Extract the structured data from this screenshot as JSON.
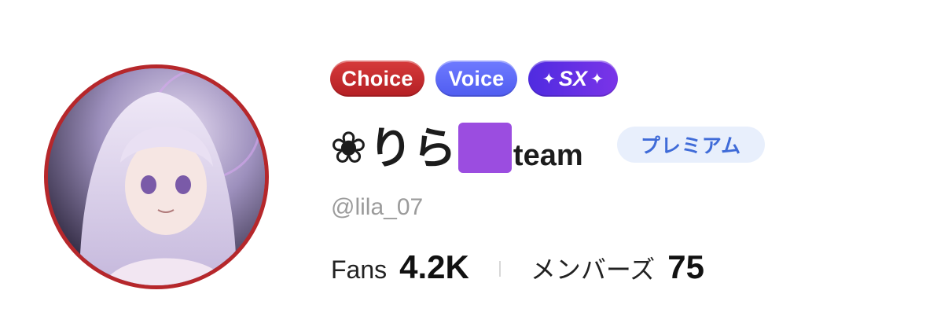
{
  "profile": {
    "badges": {
      "choice": "Choice",
      "voice": "Voice",
      "sx_text": "SX",
      "sx_spark_left": "✦",
      "sx_spark_right": "✦"
    },
    "name": {
      "flower": "❀",
      "japanese": "りら",
      "team": "team"
    },
    "premium_label": "プレミアム",
    "handle": "@lila_07",
    "stats": {
      "fans_label": "Fans",
      "fans_value": "4.2K",
      "members_label": "メンバーズ",
      "members_value": "75"
    },
    "colors": {
      "avatar_ring": "#b6272b",
      "choice_badge": "#c42a2e",
      "voice_badge": "#5d6af7",
      "sx_badge": "#6430e4",
      "purple_square": "#9b4de0",
      "premium_bg": "#e8effc",
      "premium_text": "#3f6bd8"
    }
  }
}
